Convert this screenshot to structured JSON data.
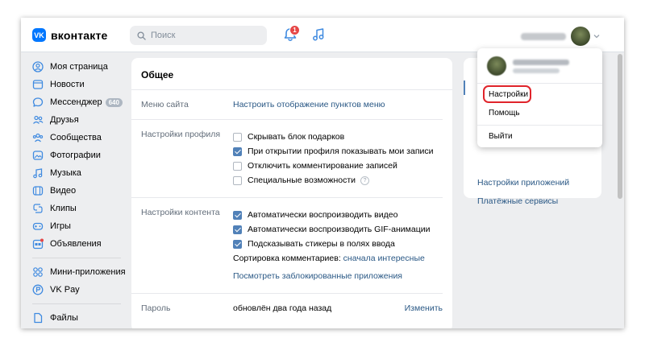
{
  "header": {
    "logo_letters": "VK",
    "logo_text": "вконтакте",
    "search_placeholder": "Поиск",
    "notifications_count": "1"
  },
  "sidebar": {
    "items": [
      {
        "label": "Моя страница",
        "icon": "user-circle-icon"
      },
      {
        "label": "Новости",
        "icon": "newspaper-icon"
      },
      {
        "label": "Мессенджер",
        "icon": "chat-bubble-icon",
        "badge": "640"
      },
      {
        "label": "Друзья",
        "icon": "friends-icon"
      },
      {
        "label": "Сообщества",
        "icon": "communities-icon"
      },
      {
        "label": "Фотографии",
        "icon": "photo-icon"
      },
      {
        "label": "Музыка",
        "icon": "music-note-icon"
      },
      {
        "label": "Видео",
        "icon": "video-icon"
      },
      {
        "label": "Клипы",
        "icon": "clips-icon"
      },
      {
        "label": "Игры",
        "icon": "gamepad-icon"
      },
      {
        "label": "Объявления",
        "icon": "ads-icon"
      },
      {
        "label": "Мини-приложения",
        "icon": "mini-apps-icon"
      },
      {
        "label": "VK Pay",
        "icon": "vkpay-icon"
      },
      {
        "label": "Файлы",
        "icon": "file-icon"
      }
    ]
  },
  "main": {
    "title": "Общее",
    "menu": {
      "label": "Меню сайта",
      "link": "Настроить отображение пунктов меню"
    },
    "profile": {
      "label": "Настройки профиля",
      "options": [
        {
          "text": "Скрывать блок подарков",
          "checked": false
        },
        {
          "text": "При открытии профиля показывать мои записи",
          "checked": true
        },
        {
          "text": "Отключить комментирование записей",
          "checked": false
        },
        {
          "text": "Специальные возможности",
          "checked": false
        }
      ],
      "help": "?"
    },
    "content": {
      "label": "Настройки контента",
      "options": [
        {
          "text": "Автоматически воспроизводить видео",
          "checked": true
        },
        {
          "text": "Автоматически воспроизводить GIF-анимации",
          "checked": true
        },
        {
          "text": "Подсказывать стикеры в полях ввода",
          "checked": true
        }
      ],
      "sort_label": "Сортировка комментариев:",
      "sort_value": "сначала интересные",
      "blocked_link": "Посмотреть заблокированные приложения"
    },
    "password": {
      "label": "Пароль",
      "value": "обновлён два года назад",
      "action": "Изменить"
    }
  },
  "right_menu": {
    "items": [
      "Настройки приложений",
      "Платёжные сервисы"
    ]
  },
  "dropdown": {
    "items": [
      "Настройки",
      "Помощь",
      "Выйти"
    ]
  },
  "colors": {
    "accent": "#0077ff",
    "link": "#2a5885",
    "checkbox": "#5181b8",
    "highlight": "#e0242b",
    "badge": "#e64646"
  }
}
